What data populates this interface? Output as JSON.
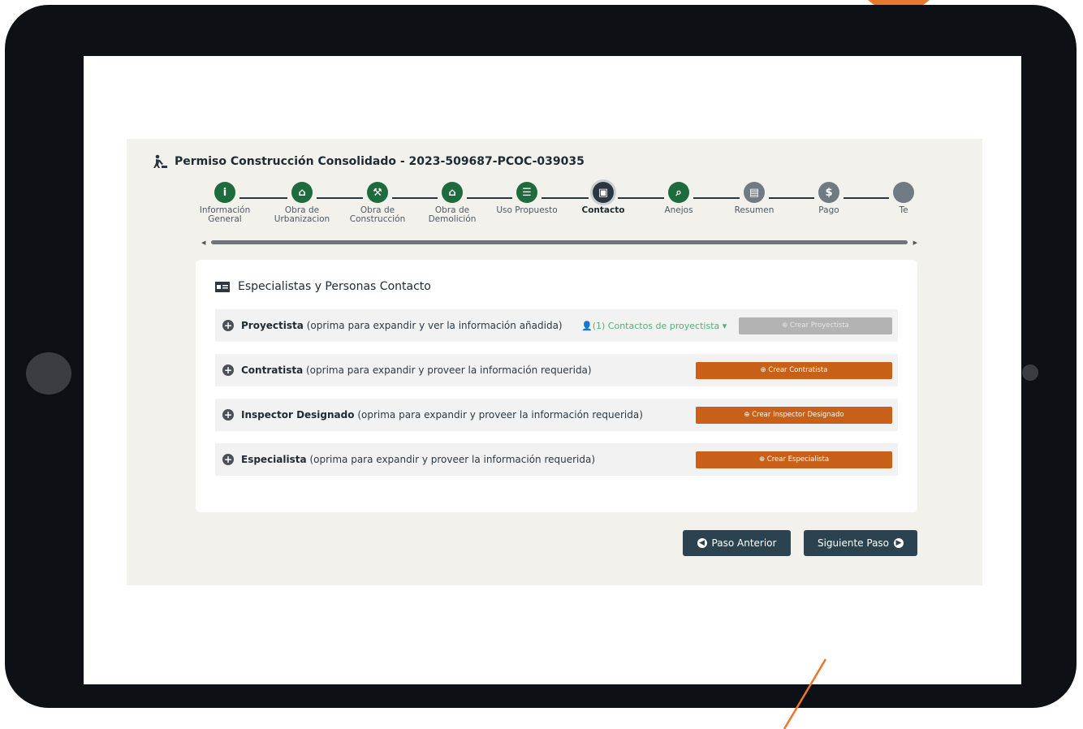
{
  "page": {
    "title": "Permiso Construcción Consolidado - 2023-509687-PCOC-039035"
  },
  "steps": [
    {
      "label": "Información General",
      "icon": "info-icon",
      "color": "#1e6b3d",
      "glyph": "i",
      "active": false
    },
    {
      "label": "Obra de Urbanizacion",
      "icon": "storefront-icon",
      "color": "#1e6b3d",
      "glyph": "⌂",
      "active": false
    },
    {
      "label": "Obra de Construcción",
      "icon": "worker-icon",
      "color": "#1e6b3d",
      "glyph": "⚒",
      "active": false
    },
    {
      "label": "Obra de Demolición",
      "icon": "house-icon",
      "color": "#1e6b3d",
      "glyph": "⌂",
      "active": false
    },
    {
      "label": "Uso Propuesto",
      "icon": "checklist-icon",
      "color": "#1e6b3d",
      "glyph": "☰",
      "active": false
    },
    {
      "label": "Contacto",
      "icon": "contact-card-icon",
      "color": "#2b3640",
      "glyph": "▣",
      "active": true
    },
    {
      "label": "Anejos",
      "icon": "paperclip-icon",
      "color": "#1e6b3d",
      "glyph": "⌕",
      "active": false
    },
    {
      "label": "Resumen",
      "icon": "document-icon",
      "color": "#707a82",
      "glyph": "▤",
      "active": false
    },
    {
      "label": "Pago",
      "icon": "dollar-icon",
      "color": "#707a82",
      "glyph": "$",
      "active": false
    },
    {
      "label": "Te",
      "icon": "partial-step-icon",
      "color": "#707a82",
      "glyph": "",
      "active": false
    }
  ],
  "section": {
    "title": "Especialistas y Personas Contacto"
  },
  "rows": [
    {
      "name": "Proyectista",
      "desc": "(oprima para expandir y ver la información añadida)",
      "contacts": "(1) Contactos de proyectista ▾",
      "button": "⊕ Crear Proyectista",
      "enabled": false
    },
    {
      "name": "Contratista",
      "desc": "(oprima para expandir y proveer la información requerida)",
      "button": "⊕ Crear Contratista",
      "enabled": true
    },
    {
      "name": "Inspector Designado",
      "desc": " (oprima para expandir y proveer la información requerida)",
      "button": "⊕ Crear Inspector Designado",
      "enabled": true
    },
    {
      "name": "Especialista",
      "desc": "(oprima para expandir y proveer la información requerida)",
      "button": "⊕ Crear Especialista",
      "enabled": true
    }
  ],
  "nav": {
    "prev": "Paso Anterior",
    "next": "Siguiente Paso"
  },
  "colors": {
    "accent_orange": "#c8601a",
    "nav_button": "#2b4350",
    "step_done": "#1e6b3d",
    "step_pending": "#707a82",
    "contacts_green": "#4fb273"
  }
}
